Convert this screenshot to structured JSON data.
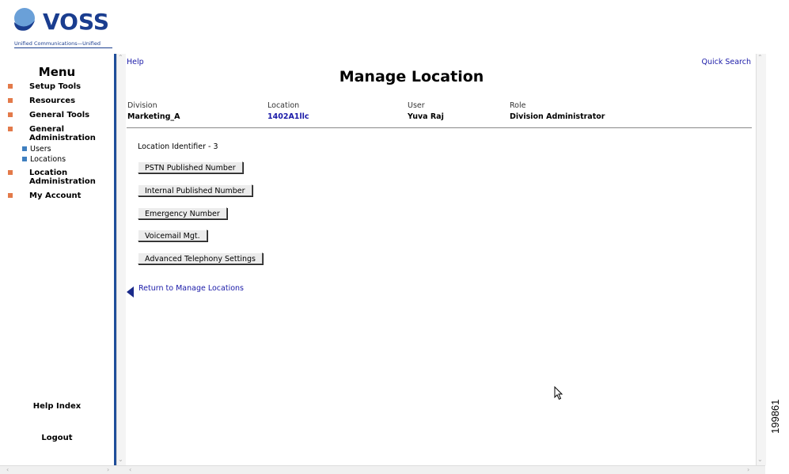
{
  "logo": {
    "name": "VOSS",
    "tagline": "Unified Communications—Unified"
  },
  "menu": {
    "title": "Menu",
    "items": [
      {
        "label": "Setup Tools"
      },
      {
        "label": "Resources"
      },
      {
        "label": "General Tools"
      },
      {
        "label": "General Administration",
        "children": [
          {
            "label": "Users"
          },
          {
            "label": "Locations"
          }
        ]
      },
      {
        "label": "Location Administration"
      },
      {
        "label": "My Account"
      }
    ],
    "help_index": "Help Index",
    "logout": "Logout",
    "colors": {
      "bullet": "#e37a4a",
      "sub_bullet": "#3f7fbf",
      "divider": "#1f4e9a"
    }
  },
  "header": {
    "help": "Help",
    "quick_search": "Quick Search",
    "title": "Manage Location"
  },
  "info": {
    "division_label": "Division",
    "division": "Marketing_A",
    "location_label": "Location",
    "location": "1402A1llc",
    "user_label": "User",
    "user": "Yuva Raj",
    "role_label": "Role",
    "role": "Division Administrator"
  },
  "location_identifier": "Location Identifier - 3",
  "buttons": {
    "pstn": "PSTN Published Number",
    "internal": "Internal Published Number",
    "emergency": "Emergency Number",
    "voicemail": "Voicemail Mgt.",
    "advanced": "Advanced Telephony Settings"
  },
  "return_link": "Return to Manage Locations",
  "figure_number": "199861"
}
